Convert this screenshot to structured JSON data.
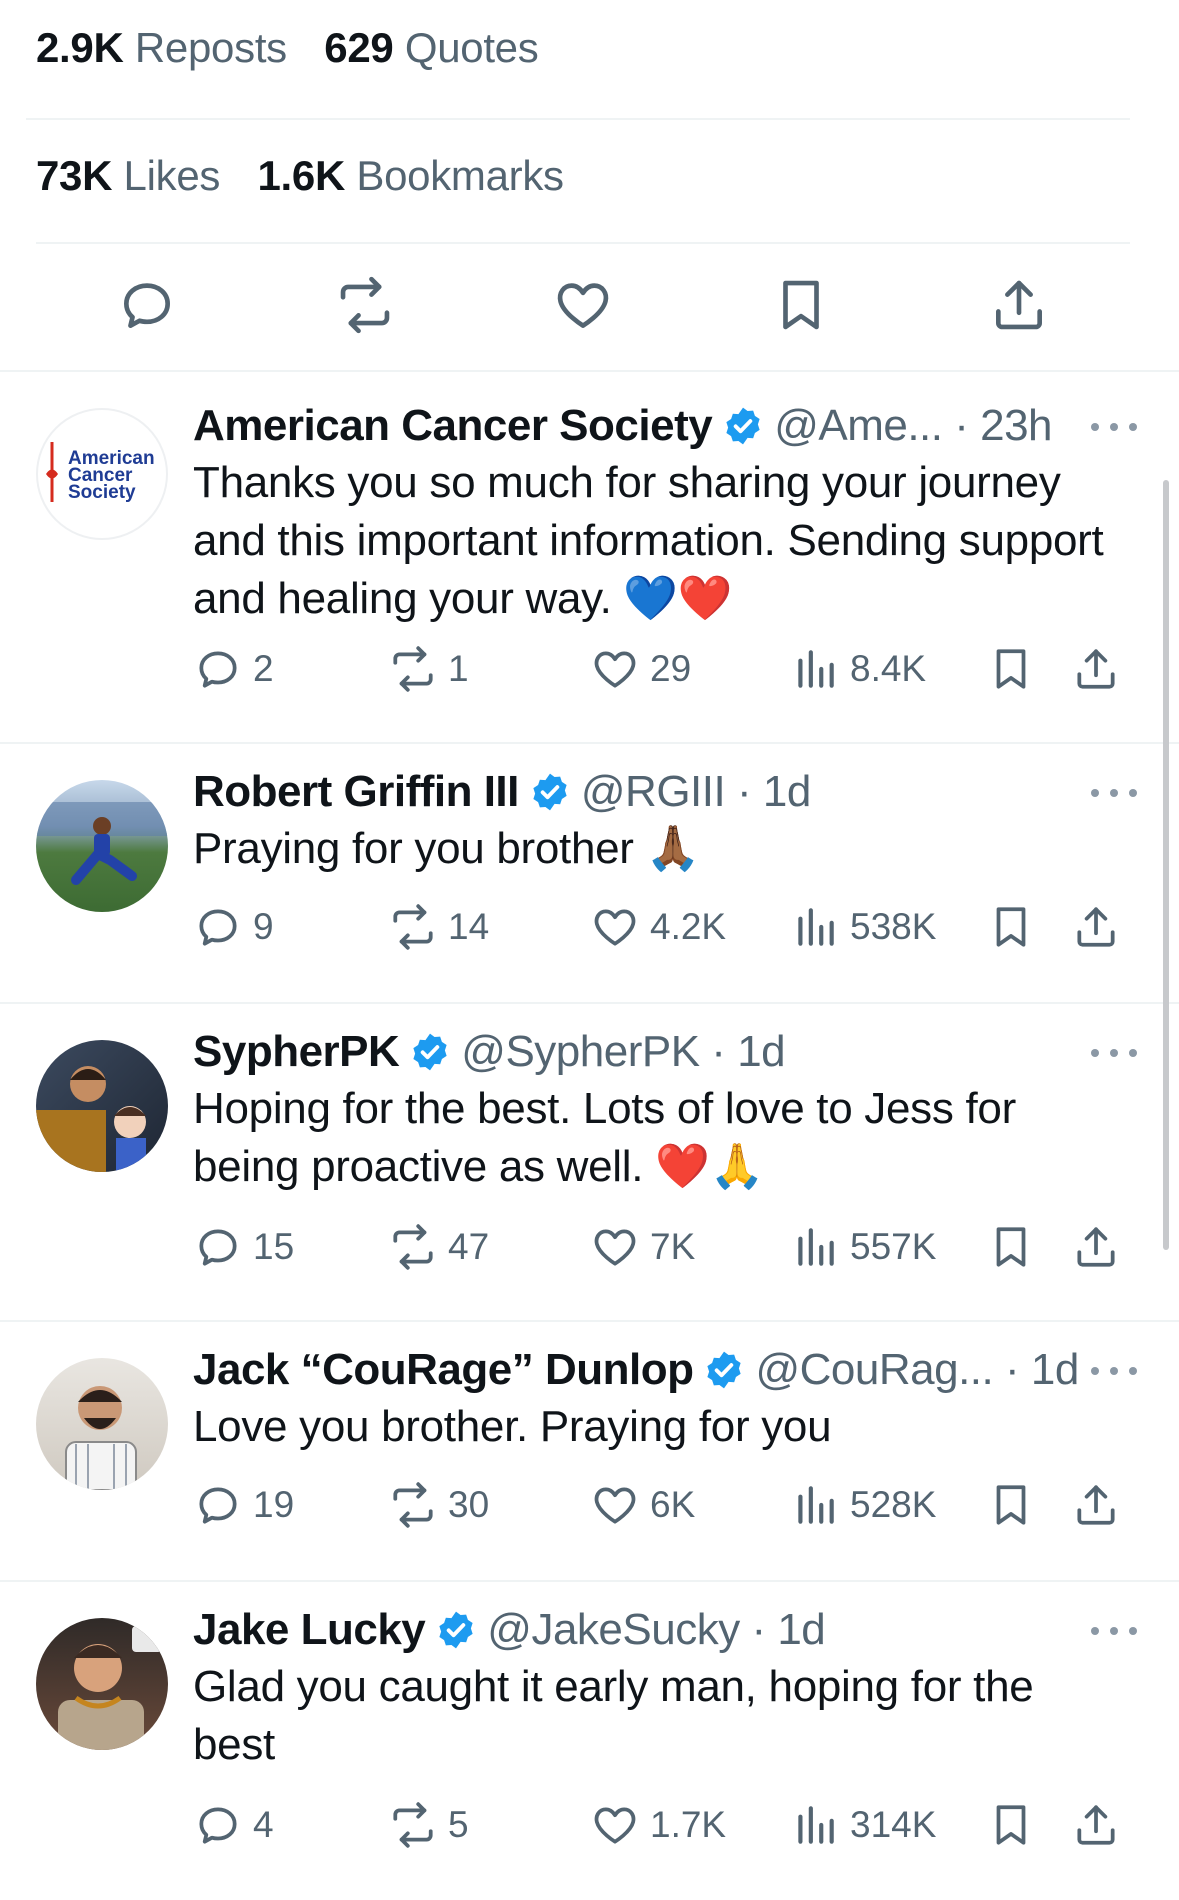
{
  "stats": {
    "reposts_count": "2.9K",
    "reposts_label": "Reposts",
    "quotes_count": "629",
    "quotes_label": "Quotes",
    "likes_count": "73K",
    "likes_label": "Likes",
    "bookmarks_count": "1.6K",
    "bookmarks_label": "Bookmarks"
  },
  "action_bar": [
    "reply-icon",
    "repost-icon",
    "like-icon",
    "bookmark-icon",
    "share-icon"
  ],
  "colors": {
    "verified": "#1d9bf0",
    "secondary_text": "#536471",
    "divider": "#eff3f4"
  },
  "replies": [
    {
      "name": "American Cancer Society",
      "handle": "@Ame...",
      "time": "23h",
      "avatar_text": [
        "American",
        "Cancer",
        "Society"
      ],
      "text": "Thanks you so much for sharing your journey and this important information. Sending support and healing your way. 💙❤️",
      "replies": "2",
      "reposts": "1",
      "likes": "29",
      "views": "8.4K"
    },
    {
      "name": "Robert Griffin III",
      "handle": "@RGIII",
      "time": "1d",
      "text": "Praying for you brother 🙏🏾",
      "replies": "9",
      "reposts": "14",
      "likes": "4.2K",
      "views": "538K"
    },
    {
      "name": "SypherPK",
      "handle": "@SypherPK",
      "time": "1d",
      "text": "Hoping for the best. Lots of love to Jess for being proactive as well. ❤️🙏",
      "replies": "15",
      "reposts": "47",
      "likes": "7K",
      "views": "557K"
    },
    {
      "name": "Jack “CouRage” Dunlop",
      "handle": "@CouRag...",
      "time": "1d",
      "text": "Love you brother. Praying for you",
      "replies": "19",
      "reposts": "30",
      "likes": "6K",
      "views": "528K"
    },
    {
      "name": "Jake Lucky",
      "handle": "@JakeSucky",
      "time": "1d",
      "text": "Glad you caught it early man, hoping for the best",
      "replies": "4",
      "reposts": "5",
      "likes": "1.7K",
      "views": "314K"
    }
  ]
}
